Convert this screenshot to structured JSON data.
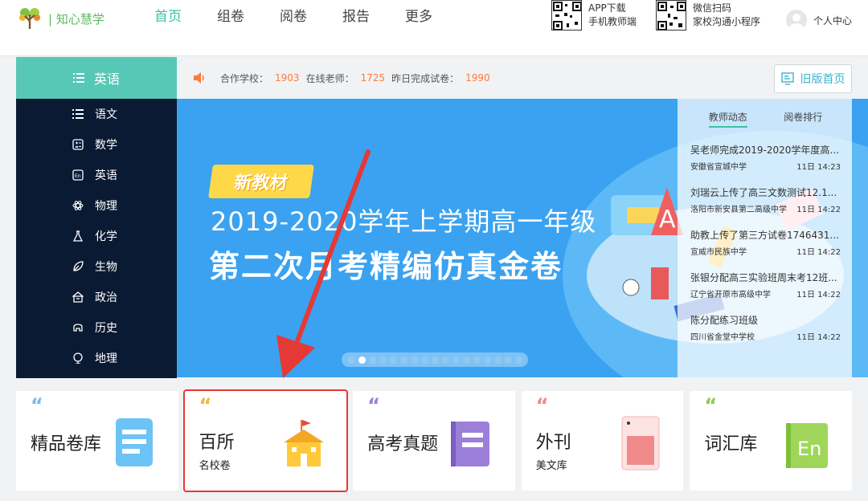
{
  "header": {
    "logo_text": "| 知心慧学",
    "nav": [
      {
        "label": "首页",
        "active": true
      },
      {
        "label": "组卷",
        "active": false
      },
      {
        "label": "阅卷",
        "active": false
      },
      {
        "label": "报告",
        "active": false
      },
      {
        "label": "更多",
        "active": false
      }
    ],
    "app_qr": {
      "line1": "APP下载",
      "line2": "手机教师端"
    },
    "wechat_qr": {
      "line1": "微信扫码",
      "line2": "家校沟通小程序"
    },
    "user_center": "个人中心"
  },
  "subjects": {
    "current": "英语",
    "items": [
      "语文",
      "数学",
      "英语",
      "物理",
      "化学",
      "生物",
      "政治",
      "历史",
      "地理"
    ],
    "icons": [
      "list-icon",
      "calculator-icon",
      "en-icon",
      "atom-icon",
      "flask-icon",
      "leaf-icon",
      "building-icon",
      "helmet-icon",
      "globe-icon"
    ]
  },
  "stats": {
    "schools_label": "合作学校：",
    "schools": "1903",
    "teachers_label": "在线老师：",
    "teachers": "1725",
    "papers_label": "昨日完成试卷：",
    "papers": "1990"
  },
  "old_home": "旧版首页",
  "banner": {
    "tag": "新教材",
    "line1": "2019-2020学年上学期高一年级",
    "line2": "第二次月考精编仿真金卷",
    "slides": 17,
    "active_slide": 1
  },
  "feed": {
    "tabs": [
      "教师动态",
      "阅卷排行"
    ],
    "items": [
      {
        "title": "吴老师完成2019-2020学年度高...",
        "school": "安徽省宣城中学",
        "time": "11日 14:23"
      },
      {
        "title": "刘瑞云上传了高三文数测试12.1...",
        "school": "洛阳市新安县第二高级中学",
        "time": "11日 14:22"
      },
      {
        "title": "助教上传了第三方试卷1746431...",
        "school": "宣威市民族中学",
        "time": "11日 14:22"
      },
      {
        "title": "张银分配高三实验班周末考12班...",
        "school": "辽宁省开原市高级中学",
        "time": "11日 14:22"
      },
      {
        "title": "陈分配练习班级",
        "school": "四川省金堂中学校",
        "time": "11日 14:22"
      }
    ]
  },
  "cards": [
    {
      "title": "精品卷库",
      "sub": "",
      "quote_color": "#7ab8ee",
      "icon": "document-icon"
    },
    {
      "title": "百所",
      "sub": "名校卷",
      "quote_color": "#f2b640",
      "icon": "school-icon"
    },
    {
      "title": "高考真题",
      "sub": "",
      "quote_color": "#9b7fd9",
      "icon": "book-icon"
    },
    {
      "title": "外刊",
      "sub": "美文库",
      "quote_color": "#f08a8a",
      "icon": "magazine-icon"
    },
    {
      "title": "词汇库",
      "sub": "",
      "quote_color": "#8ccd4f",
      "icon": "en-book-icon"
    }
  ],
  "colors": {
    "accent": "#3cc2a5",
    "sidebar": "#0b1a33",
    "banner": "#3aa2f0",
    "stat_number": "#ff7a3c",
    "highlight": "#e53935"
  }
}
